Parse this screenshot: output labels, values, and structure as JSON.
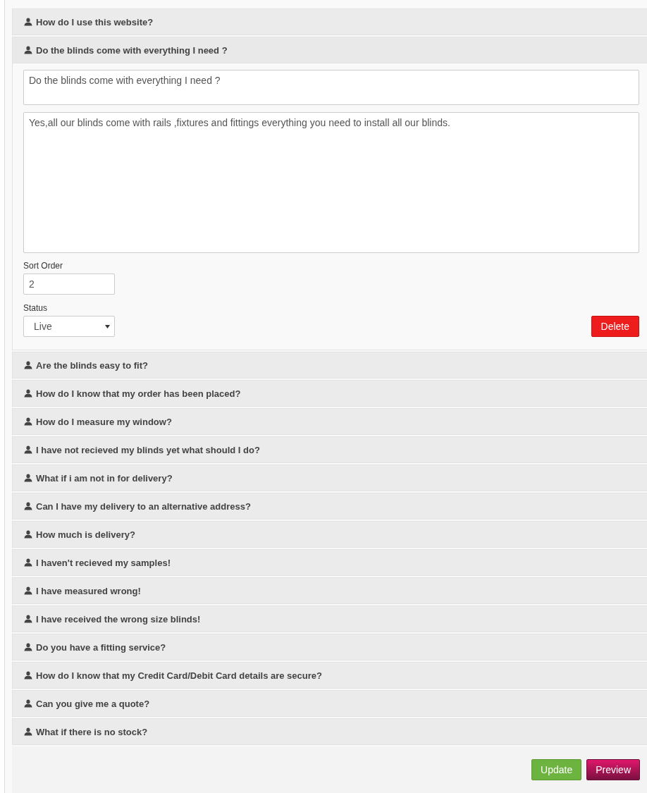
{
  "faqs": [
    {
      "question": "How do I use this website?",
      "expanded": false
    },
    {
      "question": "Do the blinds come with everything I need ?",
      "expanded": true
    },
    {
      "question": "Are the blinds easy to fit?",
      "expanded": false
    },
    {
      "question": "How do I know that my order has been placed?",
      "expanded": false
    },
    {
      "question": "How do I measure my window?",
      "expanded": false
    },
    {
      "question": "I have not recieved my blinds yet what should I do?",
      "expanded": false
    },
    {
      "question": "What if i am not in for delivery?",
      "expanded": false
    },
    {
      "question": "Can I have my delivery to an alternative address?",
      "expanded": false
    },
    {
      "question": "How much is delivery?",
      "expanded": false
    },
    {
      "question": "I haven't recieved my samples!",
      "expanded": false
    },
    {
      "question": "I have measured wrong!",
      "expanded": false
    },
    {
      "question": "I have received the wrong size blinds!",
      "expanded": false
    },
    {
      "question": "Do you have a fitting service?",
      "expanded": false
    },
    {
      "question": "How do I know that my Credit Card/Debit Card details are secure?",
      "expanded": false
    },
    {
      "question": "Can you give me a quote?",
      "expanded": false
    },
    {
      "question": "What if there is no stock?",
      "expanded": false
    }
  ],
  "editor": {
    "question_value": "Do the blinds come with everything I need ?",
    "answer_value": "Yes,all our blinds come with rails ,fixtures and fittings everything you need to install all our blinds.",
    "sort_order_label": "Sort Order",
    "sort_order_value": "2",
    "status_label": "Status",
    "status_value": "Live",
    "delete_button": "Delete"
  },
  "footer": {
    "buttons": [
      {
        "label": "Update",
        "kind": "update"
      },
      {
        "label": "Preview",
        "kind": "preview"
      }
    ]
  }
}
